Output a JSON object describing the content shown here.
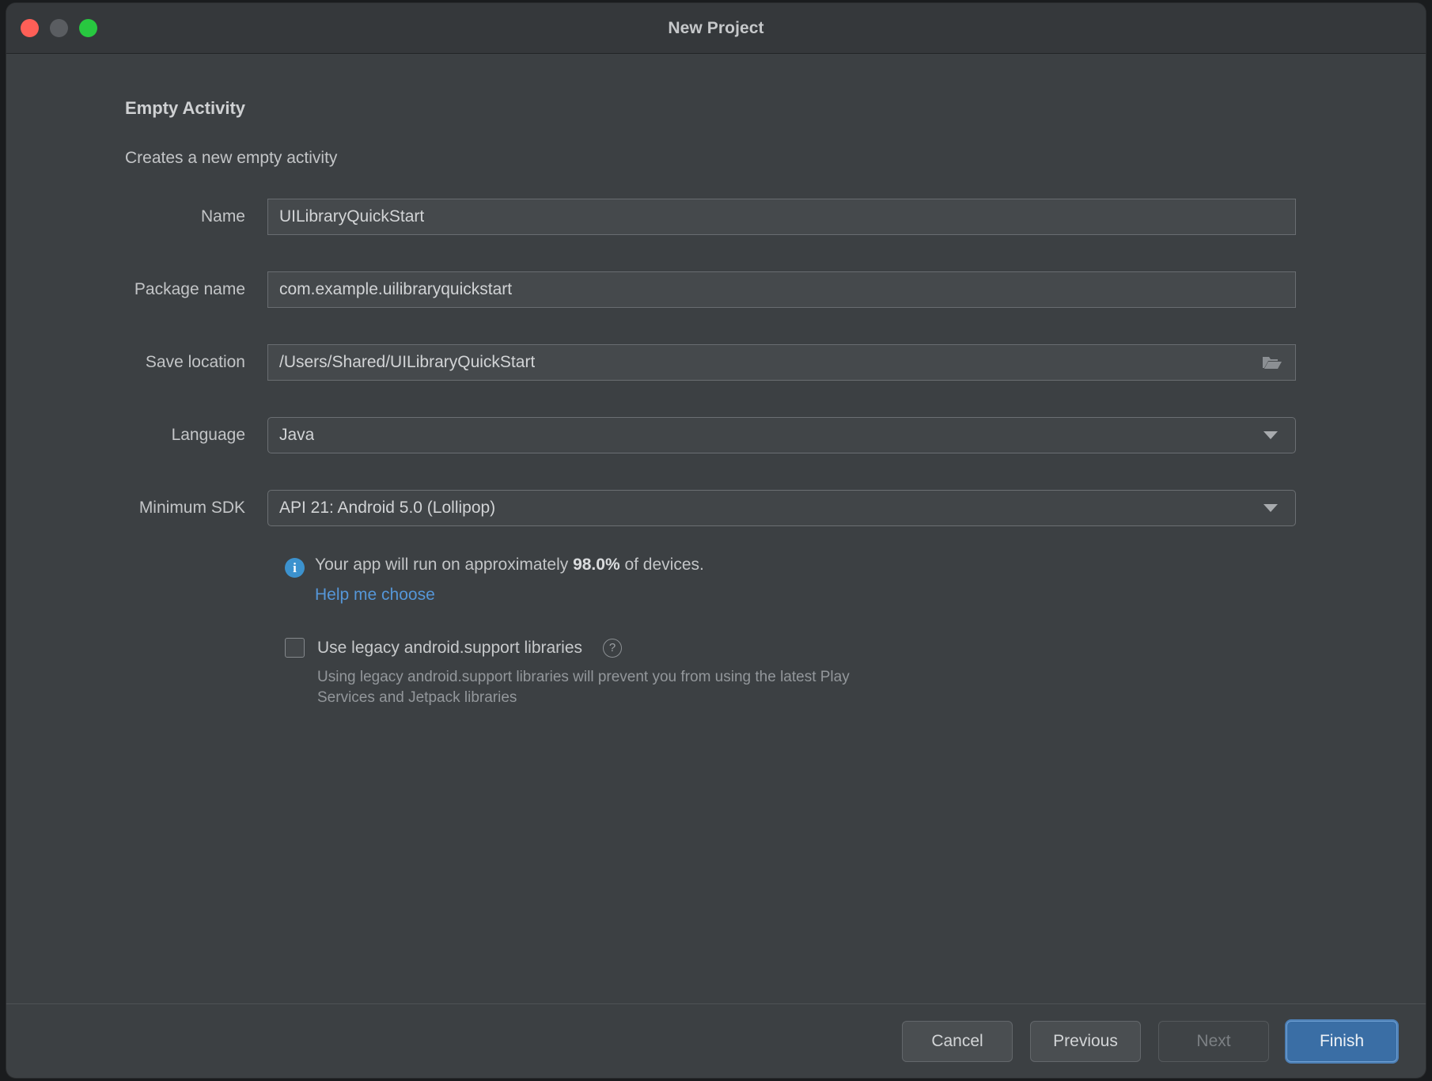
{
  "window": {
    "title": "New Project",
    "traffic_lights": [
      {
        "name": "close",
        "color": "#ff5f57"
      },
      {
        "name": "minimize",
        "color": "#5a5d61"
      },
      {
        "name": "zoom",
        "color": "#28c840"
      }
    ]
  },
  "wizard": {
    "heading": "Empty Activity",
    "subheading": "Creates a new empty activity"
  },
  "form": {
    "fields": [
      {
        "label": "Name",
        "value": "UILibraryQuickStart",
        "type": "text",
        "name": "project-name"
      },
      {
        "label": "Package name",
        "value": "com.example.uilibraryquickstart",
        "type": "text",
        "name": "package-name"
      },
      {
        "label": "Save location",
        "value": "/Users/Shared/UILibraryQuickStart",
        "type": "text-with-browse",
        "icon": "folder-icon",
        "name": "save-location"
      },
      {
        "label": "Language",
        "value": "Java",
        "type": "combo",
        "icon": "chevron-down-icon",
        "name": "language"
      },
      {
        "label": "Minimum SDK",
        "value": "API 21: Android 5.0 (Lollipop)",
        "type": "combo",
        "icon": "chevron-down-icon",
        "name": "minimum-sdk"
      }
    ]
  },
  "info": {
    "icon": "info-icon",
    "icon_glyph": "i",
    "text_before": "Your app will run on approximately ",
    "percent": "98.0%",
    "text_after": " of devices.",
    "link": "Help me choose",
    "link_color": "#5596d8",
    "icon_color": "#3c92ce"
  },
  "legacy": {
    "checked": false,
    "label": "Use legacy android.support libraries",
    "help_glyph": "?",
    "description": "Using legacy android.support libraries will prevent you from using the latest Play Services and Jetpack libraries"
  },
  "footer": {
    "buttons": [
      {
        "label": "Cancel",
        "state": "normal",
        "name": "cancel-button"
      },
      {
        "label": "Previous",
        "state": "normal",
        "name": "previous-button"
      },
      {
        "label": "Next",
        "state": "disabled",
        "name": "next-button"
      },
      {
        "label": "Finish",
        "state": "primary",
        "name": "finish-button"
      }
    ],
    "primary_color": "#3a6ea5"
  }
}
